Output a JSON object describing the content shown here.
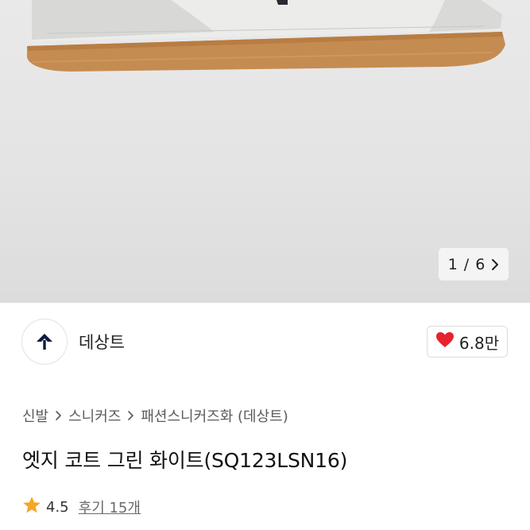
{
  "gallery": {
    "current": "1",
    "separator": "/",
    "total": "6",
    "next_icon": "chevron-right-icon"
  },
  "brand": {
    "name": "데상트",
    "logo_icon": "descente-logo-icon",
    "like_count": "6.8만",
    "like_icon": "heart-icon",
    "like_color": "#e8212e"
  },
  "breadcrumb": {
    "items": [
      "신발",
      "스니커즈",
      "패션스니커즈화 (데상트)"
    ],
    "separator_icon": "chevron-right-icon"
  },
  "product": {
    "title": "엣지 코트 그린 화이트(SQ123LSN16)"
  },
  "rating": {
    "star_icon": "star-icon",
    "star_color": "#f5a623",
    "score": "4.5",
    "review_label": "후기 15개"
  }
}
